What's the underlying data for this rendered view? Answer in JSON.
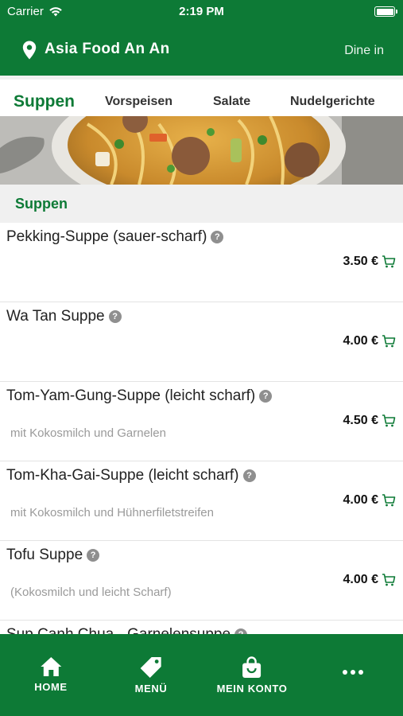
{
  "status_bar": {
    "carrier": "Carrier",
    "time": "2:19 PM"
  },
  "header": {
    "restaurant": "Asia Food An An",
    "mode": "Dine in",
    "pin_icon": "location-pin-icon"
  },
  "tabs": [
    {
      "label": "Suppen",
      "active": true
    },
    {
      "label": "Vorspeisen",
      "active": false
    },
    {
      "label": "Salate",
      "active": false
    },
    {
      "label": "Nudelgerichte",
      "active": false
    }
  ],
  "section_title": "Suppen",
  "items": [
    {
      "name": "Pekking-Suppe (sauer-scharf)",
      "description": "",
      "price": "3.50 €"
    },
    {
      "name": "Wa Tan Suppe",
      "description": "",
      "price": "4.00 €"
    },
    {
      "name": "Tom-Yam-Gung-Suppe (leicht scharf)",
      "description": "mit Kokosmilch und Garnelen",
      "price": "4.50 €"
    },
    {
      "name": "Tom-Kha-Gai-Suppe (leicht scharf)",
      "description": "mit Kokosmilch und Hühnerfiletstreifen",
      "price": "4.00 €"
    },
    {
      "name": "Tofu Suppe",
      "description": "(Kokosmilch und leicht Scharf)",
      "price": "4.00 €"
    },
    {
      "name": "Sup Canh Chua - Garnelensuppe",
      "description": "",
      "price": ""
    }
  ],
  "bottom_nav": [
    {
      "label": "HOME",
      "icon": "home-icon"
    },
    {
      "label": "MENÜ",
      "icon": "tag-icon"
    },
    {
      "label": "MEIN KONTO",
      "icon": "shopping-bag-icon"
    },
    {
      "label": "",
      "icon": "more-dots-icon"
    }
  ],
  "colors": {
    "brand_green": "#0d7a36",
    "section_bg": "#f0f0f0"
  }
}
